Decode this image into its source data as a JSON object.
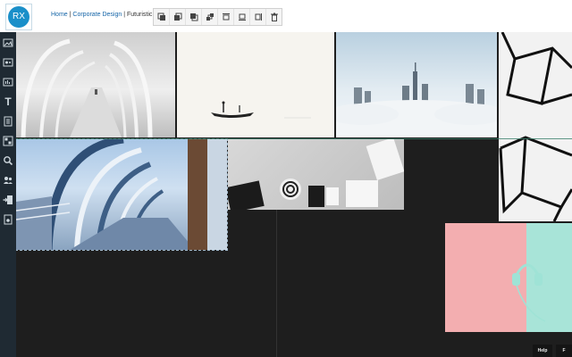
{
  "header": {
    "logo_text": "RX",
    "breadcrumb": {
      "home": "Home",
      "sep1": " | ",
      "corporate": "Corporate Design",
      "sep2": " | ",
      "current": "Futuristic"
    }
  },
  "toolbar": {
    "buttons": [
      {
        "name": "bring-to-front-icon"
      },
      {
        "name": "bring-forward-icon"
      },
      {
        "name": "send-backward-icon"
      },
      {
        "name": "send-to-back-icon"
      },
      {
        "name": "align-top-icon"
      },
      {
        "name": "align-bottom-icon"
      },
      {
        "name": "align-right-icon"
      },
      {
        "name": "trash-icon"
      }
    ]
  },
  "sidebar": {
    "items": [
      {
        "name": "image-tool-icon"
      },
      {
        "name": "video-tool-icon"
      },
      {
        "name": "audio-tool-icon"
      },
      {
        "name": "text-tool-icon",
        "glyph": "T"
      },
      {
        "name": "document-tool-icon"
      },
      {
        "name": "layout-tool-icon"
      },
      {
        "name": "search-icon"
      },
      {
        "name": "users-icon"
      },
      {
        "name": "import-icon"
      },
      {
        "name": "export-icon"
      }
    ]
  },
  "footer": {
    "help_label": "Help",
    "second_label": "F"
  },
  "colors": {
    "brand": "#1a8fc9",
    "sidebar_bg": "#1f2a33",
    "canvas_bg": "#1e1e1e",
    "link": "#1565a8"
  }
}
